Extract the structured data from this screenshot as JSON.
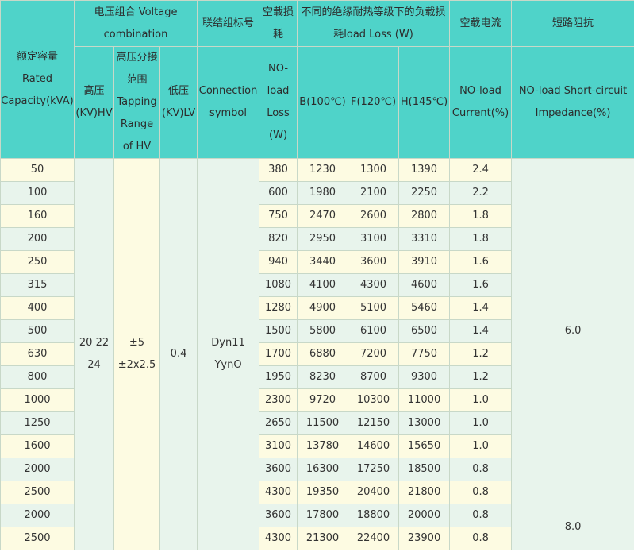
{
  "headers": {
    "rated_capacity": "额定容量 Rated Capacity(kVA)",
    "voltage_combination": "电压组合 Voltage combination",
    "hv": "高压(KV)HV",
    "tapping_range": "高压分接范围 Tapping Range of HV",
    "lv": "低压(KV)LV",
    "connection_symbol_group": "联结组标号",
    "connection_symbol": "Connection symbol",
    "noload_loss_group": "空载损耗",
    "noload_loss": "NO-load Loss (W)",
    "load_loss_group": "不同的绝缘耐热等级下的负载损耗load Loss (W)",
    "load_loss_b": "B(100℃)",
    "load_loss_f": "F(120℃)",
    "load_loss_h": "H(145℃)",
    "noload_current_group": "空载电流",
    "noload_current": "NO-load Current(%)",
    "short_circuit_group": "短路阻抗",
    "short_circuit": "NO-load Short-circuit Impedance(%)"
  },
  "merged": {
    "hv_values": "20 22 24",
    "tapping_values": "±5 ±2x2.5",
    "lv_value": "0.4",
    "connection_values": "Dyn11 YynO",
    "impedance_a": "6.0",
    "impedance_b": "8.0"
  },
  "rows": [
    {
      "capacity": "50",
      "noload_loss": "380",
      "b": "1230",
      "f": "1300",
      "h": "1390",
      "current": "2.4"
    },
    {
      "capacity": "100",
      "noload_loss": "600",
      "b": "1980",
      "f": "2100",
      "h": "2250",
      "current": "2.2"
    },
    {
      "capacity": "160",
      "noload_loss": "750",
      "b": "2470",
      "f": "2600",
      "h": "2800",
      "current": "1.8"
    },
    {
      "capacity": "200",
      "noload_loss": "820",
      "b": "2950",
      "f": "3100",
      "h": "3310",
      "current": "1.8"
    },
    {
      "capacity": "250",
      "noload_loss": "940",
      "b": "3440",
      "f": "3600",
      "h": "3910",
      "current": "1.6"
    },
    {
      "capacity": "315",
      "noload_loss": "1080",
      "b": "4100",
      "f": "4300",
      "h": "4600",
      "current": "1.6"
    },
    {
      "capacity": "400",
      "noload_loss": "1280",
      "b": "4900",
      "f": "5100",
      "h": "5460",
      "current": "1.4"
    },
    {
      "capacity": "500",
      "noload_loss": "1500",
      "b": "5800",
      "f": "6100",
      "h": "6500",
      "current": "1.4"
    },
    {
      "capacity": "630",
      "noload_loss": "1700",
      "b": "6880",
      "f": "7200",
      "h": "7750",
      "current": "1.2"
    },
    {
      "capacity": "800",
      "noload_loss": "1950",
      "b": "8230",
      "f": "8700",
      "h": "9300",
      "current": "1.2"
    },
    {
      "capacity": "1000",
      "noload_loss": "2300",
      "b": "9720",
      "f": "10300",
      "h": "11000",
      "current": "1.0"
    },
    {
      "capacity": "1250",
      "noload_loss": "2650",
      "b": "11500",
      "f": "12150",
      "h": "13000",
      "current": "1.0"
    },
    {
      "capacity": "1600",
      "noload_loss": "3100",
      "b": "13780",
      "f": "14600",
      "h": "15650",
      "current": "1.0"
    },
    {
      "capacity": "2000",
      "noload_loss": "3600",
      "b": "16300",
      "f": "17250",
      "h": "18500",
      "current": "0.8"
    },
    {
      "capacity": "2500",
      "noload_loss": "4300",
      "b": "19350",
      "f": "20400",
      "h": "21800",
      "current": "0.8"
    },
    {
      "capacity": "2000",
      "noload_loss": "3600",
      "b": "17800",
      "f": "18800",
      "h": "20000",
      "current": "0.8"
    },
    {
      "capacity": "2500",
      "noload_loss": "4300",
      "b": "21300",
      "f": "22400",
      "h": "23900",
      "current": "0.8"
    }
  ]
}
